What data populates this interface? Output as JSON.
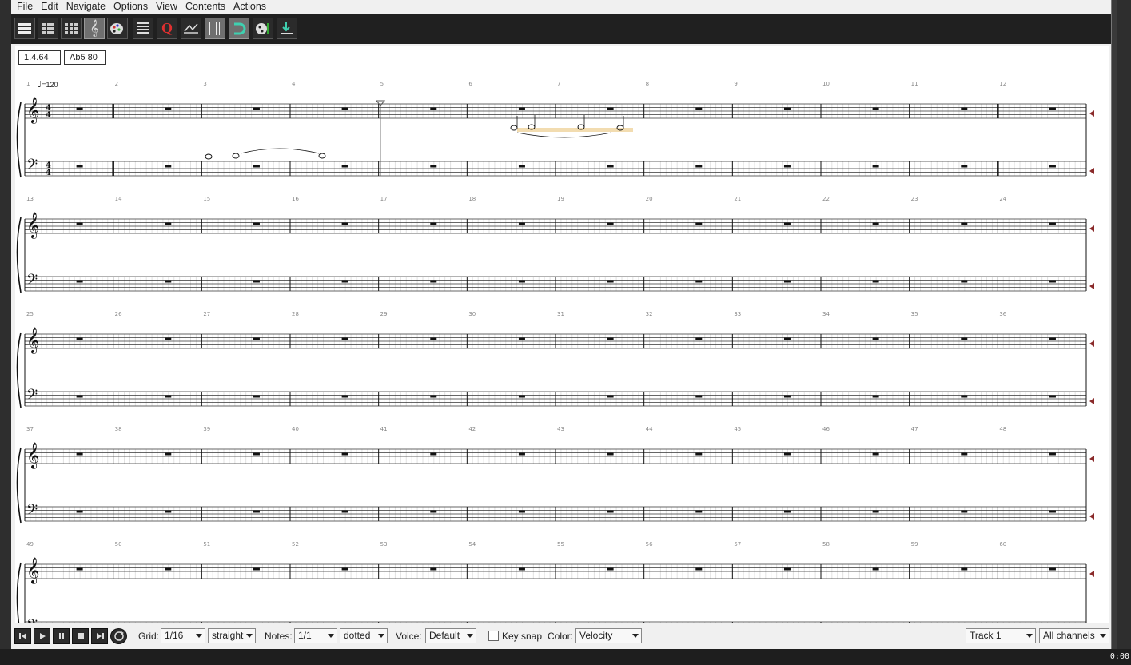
{
  "menu": [
    "File",
    "Edit",
    "Navigate",
    "Options",
    "View",
    "Contents",
    "Actions"
  ],
  "toolbar_icons": [
    "page-view-icon",
    "score-view-icon",
    "grid-view-icon",
    "treble-clef-icon",
    "palette-icon",
    "event-list-icon",
    "quantize-icon",
    "transform-icon",
    "dotted-grid-icon",
    "magnet-icon",
    "color-palette-icon",
    "insert-icon"
  ],
  "status": {
    "position": "1.4.64",
    "note": "Ab5  80"
  },
  "tempo": "=120",
  "measures_per_system": 12,
  "systems": 5,
  "time_signature": {
    "top": "4",
    "bottom": "4"
  },
  "bottom": {
    "grid_label": "Grid:",
    "grid_value": "1/16",
    "grid_mode": "straight",
    "notes_label": "Notes:",
    "notes_value": "1/1",
    "notes_mode": "dotted",
    "voice_label": "Voice:",
    "voice_value": "Default",
    "keysnap_label": "Key snap",
    "color_label": "Color:",
    "color_value": "Velocity",
    "track_value": "Track 1",
    "channels_value": "All channels"
  },
  "clock": "0:00",
  "colors": {
    "toolbar": "#202020",
    "score_bg": "#ffffff",
    "highlight": "#f2dcb0",
    "marker": "#8a2a2a"
  }
}
